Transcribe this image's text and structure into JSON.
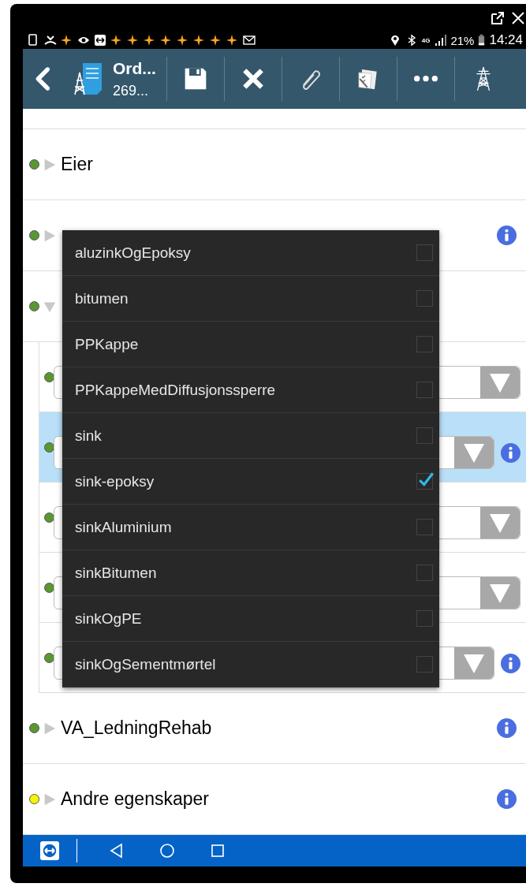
{
  "status_bar": {
    "network": "4G",
    "battery": "21%",
    "time": "14:24"
  },
  "toolbar": {
    "title": "Ord...",
    "subtitle": "269..."
  },
  "sections": [
    {
      "label": "Eier",
      "color": "#5a9632",
      "expanded": false,
      "info": false
    },
    {
      "color": "#5a9632",
      "expanded": false,
      "info": true
    },
    {
      "color": "#5a9632",
      "expanded": true,
      "info": false,
      "children": [
        {
          "color": "#5a9632",
          "selected": false,
          "info": false
        },
        {
          "color": "#5a9632",
          "selected": true,
          "info": true
        },
        {
          "color": "#5a9632",
          "selected": false,
          "info": false
        },
        {
          "color": "#5a9632",
          "selected": false,
          "info": false
        },
        {
          "color": "#5a9632",
          "selected": false,
          "info": true
        }
      ]
    },
    {
      "label": "VA_LedningRehab",
      "color": "#5a9632",
      "expanded": false,
      "info": true
    },
    {
      "label": "Andre egenskaper",
      "color": "#f5f500",
      "expanded": false,
      "info": true
    }
  ],
  "dropdown_options": [
    {
      "label": "aluzinkOgEpoksy",
      "checked": false
    },
    {
      "label": "bitumen",
      "checked": false
    },
    {
      "label": "PPKappe",
      "checked": false
    },
    {
      "label": "PPKappeMedDiffusjonssperre",
      "checked": false
    },
    {
      "label": "sink",
      "checked": false
    },
    {
      "label": "sink-epoksy",
      "checked": true
    },
    {
      "label": "sinkAluminium",
      "checked": false
    },
    {
      "label": "sinkBitumen",
      "checked": false
    },
    {
      "label": "sinkOgPE",
      "checked": false
    },
    {
      "label": "sinkOgSementmørtel",
      "checked": false
    }
  ]
}
